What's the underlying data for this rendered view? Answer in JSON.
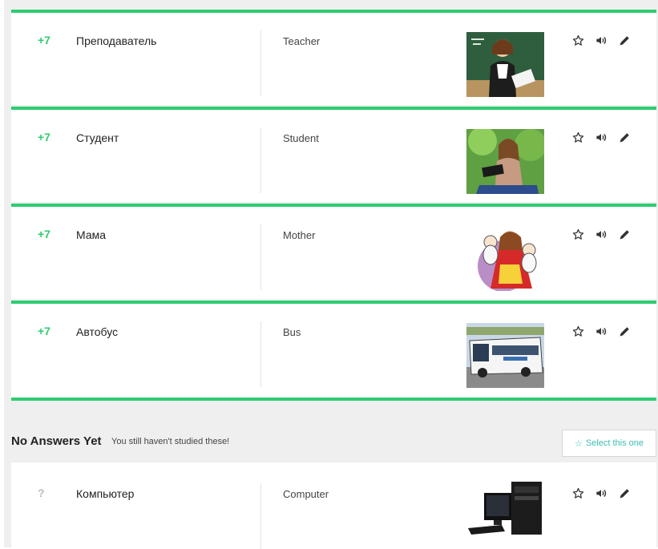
{
  "items": [
    {
      "score": "+7",
      "word": "Преподаватель",
      "translation": "Teacher",
      "image": "teacher-photo"
    },
    {
      "score": "+7",
      "word": "Студент",
      "translation": "Student",
      "image": "student-photo"
    },
    {
      "score": "+7",
      "word": "Мама",
      "translation": "Mother",
      "image": "mother-illustration"
    },
    {
      "score": "+7",
      "word": "Автобус",
      "translation": "Bus",
      "image": "bus-photo"
    }
  ],
  "no_answers": {
    "title": "No Answers Yet",
    "subtitle": "You still haven't studied these!",
    "select_button": "Select this one",
    "items": [
      {
        "score": "?",
        "word": "Компьютер",
        "translation": "Computer",
        "image": "computer-photo"
      }
    ]
  },
  "icons": {
    "favorite": "star-outline-icon",
    "audio": "speaker-icon",
    "edit": "pencil-icon"
  },
  "colors": {
    "accent_green": "#2ecc71",
    "select_teal": "#3cc0b4",
    "background": "#efefef"
  }
}
